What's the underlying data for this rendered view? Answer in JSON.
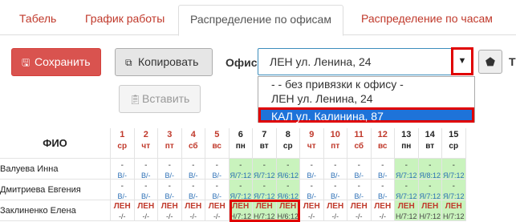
{
  "tabs": [
    {
      "label": "Табель"
    },
    {
      "label": "График работы"
    },
    {
      "label": "Распределение по офисам"
    },
    {
      "label": "Распределение по часам"
    }
  ],
  "toolbar": {
    "save_label": "Сохранить",
    "copy_label": "Копировать",
    "paste_label": "Вставить",
    "office_label": "Офис",
    "office_selected": "ЛЕН ул. Ленина, 24",
    "trailing_label": "Т"
  },
  "office_options": [
    "- - без привязки к офису -",
    "ЛЕН ул. Ленина, 24",
    "КАЛ ул. Калинина, 87"
  ],
  "table": {
    "fio_header": "ФИО",
    "days": [
      {
        "num": "1",
        "dow": "ср"
      },
      {
        "num": "2",
        "dow": "чт"
      },
      {
        "num": "3",
        "dow": "пт"
      },
      {
        "num": "4",
        "dow": "сб"
      },
      {
        "num": "5",
        "dow": "вс"
      },
      {
        "num": "6",
        "dow": "пн"
      },
      {
        "num": "7",
        "dow": "вт"
      },
      {
        "num": "8",
        "dow": "ср"
      },
      {
        "num": "9",
        "dow": "чт"
      },
      {
        "num": "10",
        "dow": "пт"
      },
      {
        "num": "11",
        "dow": "сб"
      },
      {
        "num": "12",
        "dow": "вс"
      },
      {
        "num": "13",
        "dow": "пн"
      },
      {
        "num": "14",
        "dow": "вт"
      },
      {
        "num": "15",
        "dow": "ср"
      }
    ],
    "rows": [
      {
        "name": "Валуева Инна",
        "cells": [
          [
            "-",
            "В/-"
          ],
          [
            "-",
            "В/-"
          ],
          [
            "-",
            "В/-"
          ],
          [
            "-",
            "В/-"
          ],
          [
            "-",
            "В/-"
          ],
          [
            "-",
            "Я/7:12"
          ],
          [
            "-",
            "Я/7:12"
          ],
          [
            "-",
            "Я/6:12"
          ],
          [
            "-",
            "В/-"
          ],
          [
            "-",
            "В/-"
          ],
          [
            "-",
            "В/-"
          ],
          [
            "-",
            "В/-"
          ],
          [
            "-",
            "Я/7:12"
          ],
          [
            "-",
            "Я/8:12"
          ],
          [
            "-",
            "Я/7:12"
          ]
        ]
      },
      {
        "name": "Дмитриева Евгения",
        "cells": [
          [
            "-",
            "В/-"
          ],
          [
            "-",
            "В/-"
          ],
          [
            "-",
            "В/-"
          ],
          [
            "-",
            "В/-"
          ],
          [
            "-",
            "В/-"
          ],
          [
            "-",
            "Я/7:12"
          ],
          [
            "-",
            "Я/7:12"
          ],
          [
            "-",
            "Я/6:12"
          ],
          [
            "-",
            "В/-"
          ],
          [
            "-",
            "В/-"
          ],
          [
            "-",
            "В/-"
          ],
          [
            "-",
            "В/-"
          ],
          [
            "-",
            "Я/7:12"
          ],
          [
            "-",
            "Я/7:12"
          ],
          [
            "-",
            "Я/7:12"
          ]
        ]
      },
      {
        "name": "Заклиненко Елена",
        "cells": [
          [
            "ЛЕН",
            "-/-"
          ],
          [
            "ЛЕН",
            "-/-"
          ],
          [
            "ЛЕН",
            "-/-"
          ],
          [
            "ЛЕН",
            "-/-"
          ],
          [
            "ЛЕН",
            "-/-"
          ],
          [
            "ЛЕН",
            "Н/7:12"
          ],
          [
            "ЛЕН",
            "Н/7:12"
          ],
          [
            "ЛЕН",
            "Н/6:12"
          ],
          [
            "ЛЕН",
            "-/-"
          ],
          [
            "ЛЕН",
            "-/-"
          ],
          [
            "ЛЕН",
            "-/-"
          ],
          [
            "ЛЕН",
            "-/-"
          ],
          [
            "ЛЕН",
            "Н/7:12"
          ],
          [
            "ЛЕН",
            "Н/7:12"
          ],
          [
            "ЛЕН",
            "Н/7:12"
          ]
        ]
      }
    ]
  }
}
